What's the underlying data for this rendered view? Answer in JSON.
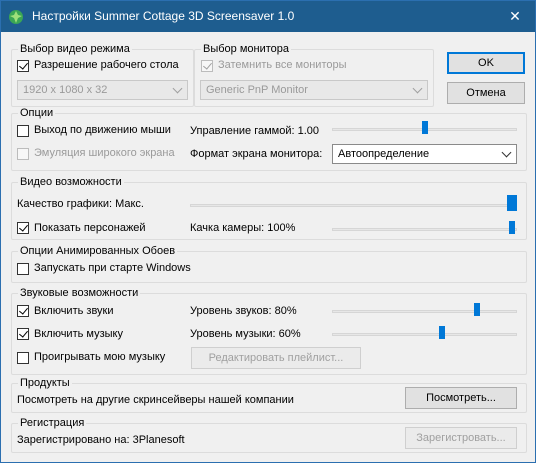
{
  "window": {
    "title": "Настройки Summer Cottage 3D Screensaver 1.0",
    "close_glyph": "✕",
    "accent_color": "#1e5d8f"
  },
  "video_mode": {
    "legend": "Выбор видео режима",
    "desktop_resolution_label": "Разрешение рабочего стола",
    "desktop_resolution_checked": true,
    "resolution_value": "1920 x 1080 x 32"
  },
  "monitor": {
    "legend": "Выбор монитора",
    "dim_all_label": "Затемнить все мониторы",
    "dim_all_checked": true,
    "monitor_value": "Generic PnP Monitor"
  },
  "buttons": {
    "ok": "OK",
    "cancel": "Отмена"
  },
  "options": {
    "legend": "Опции",
    "exit_on_mouse_label": "Выход по движению мыши",
    "exit_on_mouse_checked": false,
    "widescreen_label": "Эмуляция широкого экрана",
    "widescreen_checked": false,
    "gamma_label": "Управление гаммой: 1.00",
    "gamma_level": 0.5,
    "aspect_label": "Формат экрана монитора:",
    "aspect_value": "Автоопределение"
  },
  "video_features": {
    "legend": "Видео возможности",
    "quality_label": "Качество графики: Макс.",
    "quality_level": 1.0,
    "show_characters_label": "Показать персонажей",
    "show_characters_checked": true,
    "camera_label": "Качка камеры: 100%",
    "camera_level": 1.0
  },
  "wallpaper": {
    "legend": "Опции Анимированных Обоев",
    "autostart_label": "Запускать при старте Windows",
    "autostart_checked": false
  },
  "sound": {
    "legend": "Звуковые возможности",
    "enable_sounds_label": "Включить звуки",
    "enable_sounds_checked": true,
    "sound_level_label": "Уровень звуков: 80%",
    "sound_level": 0.8,
    "enable_music_label": "Включить музыку",
    "enable_music_checked": true,
    "music_level_label": "Уровень музыки: 60%",
    "music_level": 0.6,
    "own_music_label": "Проигрывать мою музыку",
    "own_music_checked": false,
    "edit_playlist_button": "Редактировать плейлист..."
  },
  "products": {
    "legend": "Продукты",
    "text": "Посмотреть на другие скринсейверы нашей компании",
    "view_button": "Посмотреть..."
  },
  "registration": {
    "legend": "Регистрация",
    "text": "Зарегистрировано на: 3Planesoft",
    "register_button": "Зарегистровать..."
  }
}
